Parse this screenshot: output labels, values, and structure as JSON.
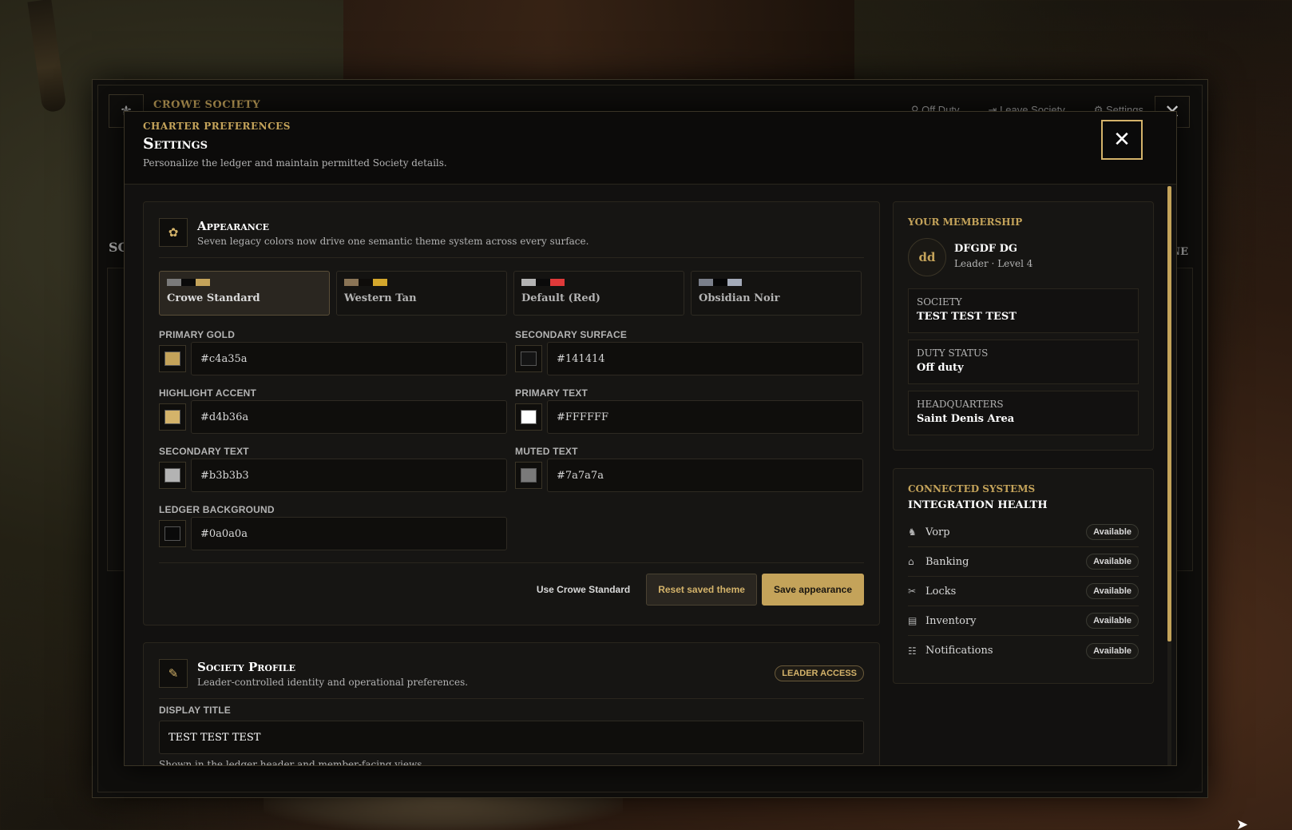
{
  "background": {
    "cursor_icon": "arrow-cursor-icon"
  },
  "ledger": {
    "title": "CROWE SOCIETY",
    "logo_icon": "society-crest-icon",
    "actions": [
      {
        "icon": "duty-icon",
        "label": "Off Duty"
      },
      {
        "icon": "exit-icon",
        "label": "Leave Society"
      },
      {
        "icon": "gear-icon",
        "label": "Settings"
      }
    ],
    "left_label": "SC",
    "right_label": "NE"
  },
  "modal": {
    "eyebrow": "CHARTER PREFERENCES",
    "title": "Settings",
    "subtitle": "Personalize the ledger and maintain permitted Society details.",
    "close_icon": "close-icon"
  },
  "appearance": {
    "icon": "rosette-icon",
    "title": "Appearance",
    "subtitle": "Seven legacy colors now drive one semantic theme system across every surface.",
    "presets": [
      {
        "name": "Crowe Standard",
        "colors": [
          "#7a7a7a",
          "#0a0a0a",
          "#c4a35a"
        ],
        "active": true
      },
      {
        "name": "Western Tan",
        "colors": [
          "#8a7456",
          "#0e0c0a",
          "#d4a72c"
        ],
        "active": false
      },
      {
        "name": "Default (Red)",
        "colors": [
          "#b3b3b3",
          "#0a0a0a",
          "#e03a3a"
        ],
        "active": false
      },
      {
        "name": "Obsidian Noir",
        "colors": [
          "#7a7f8a",
          "#050505",
          "#a3aab8"
        ],
        "active": false
      }
    ],
    "fields": [
      {
        "label": "PRIMARY GOLD",
        "value": "#c4a35a",
        "swatch": "#c4a35a"
      },
      {
        "label": "SECONDARY SURFACE",
        "value": "#141414",
        "swatch": "#141414"
      },
      {
        "label": "HIGHLIGHT ACCENT",
        "value": "#d4b36a",
        "swatch": "#d4b36a"
      },
      {
        "label": "PRIMARY TEXT",
        "value": "#FFFFFF",
        "swatch": "#FFFFFF"
      },
      {
        "label": "SECONDARY TEXT",
        "value": "#b3b3b3",
        "swatch": "#b3b3b3"
      },
      {
        "label": "MUTED TEXT",
        "value": "#7a7a7a",
        "swatch": "#7a7a7a"
      },
      {
        "label": "LEDGER BACKGROUND",
        "value": "#0a0a0a",
        "swatch": "#0a0a0a"
      }
    ],
    "buttons": {
      "use_standard": "Use Crowe Standard",
      "reset": "Reset saved theme",
      "save": "Save appearance"
    }
  },
  "profile": {
    "icon": "scroll-icon",
    "title": "Society Profile",
    "subtitle": "Leader-controlled identity and operational preferences.",
    "badge": "LEADER ACCESS",
    "display_title_label": "DISPLAY TITLE",
    "display_title_value": "TEST TEST TEST",
    "display_title_help": "Shown in the ledger header and member-facing views."
  },
  "membership": {
    "eyebrow": "YOUR MEMBERSHIP",
    "avatar_initials": "dd",
    "name": "DFGDF DG",
    "role": "Leader · Level 4",
    "info": [
      {
        "label": "SOCIETY",
        "value": "TEST TEST TEST"
      },
      {
        "label": "DUTY STATUS",
        "value": "Off duty"
      },
      {
        "label": "HEADQUARTERS",
        "value": "Saint Denis Area"
      }
    ]
  },
  "systems": {
    "eyebrow": "CONNECTED SYSTEMS",
    "title": "INTEGRATION HEALTH",
    "items": [
      {
        "icon": "horse-icon",
        "name": "Vorp",
        "status": "Available"
      },
      {
        "icon": "bank-icon",
        "name": "Banking",
        "status": "Available"
      },
      {
        "icon": "lockpick-icon",
        "name": "Locks",
        "status": "Available"
      },
      {
        "icon": "inventory-icon",
        "name": "Inventory",
        "status": "Available"
      },
      {
        "icon": "notification-icon",
        "name": "Notifications",
        "status": "Available"
      }
    ]
  }
}
